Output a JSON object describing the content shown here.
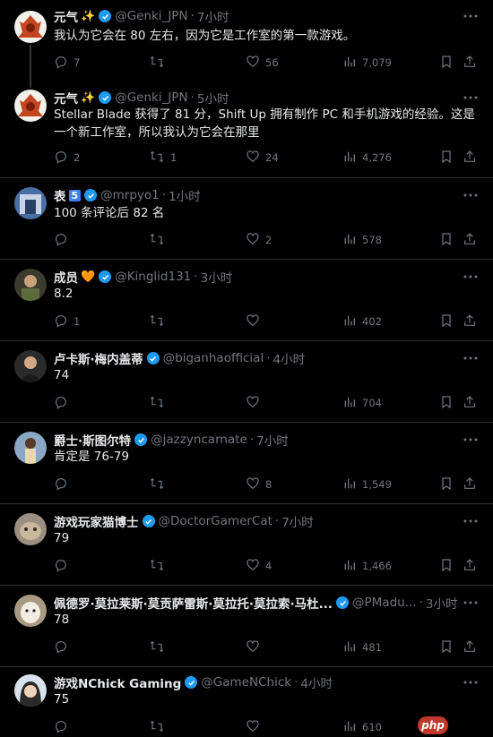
{
  "tweets": [
    {
      "name": "元气",
      "name_emoji": "✨",
      "handle": "@Genki_JPN",
      "time": "7小时",
      "text": "我认为它会在 80 左右，因为它是工作室的第一款游戏。",
      "replies": "7",
      "reposts": "",
      "likes": "56",
      "views": "7,079"
    },
    {
      "name": "元气",
      "name_emoji": "✨",
      "handle": "@Genki_JPN",
      "time": "5小时",
      "text": "Stellar Blade 获得了 81 分，Shift Up 拥有制作 PC 和手机游戏的经验。这是一个新工作室，所以我认为它会在那里",
      "replies": "2",
      "reposts": "1",
      "likes": "24",
      "views": "4,276"
    },
    {
      "name": "表",
      "name_emoji": "5",
      "handle": "@mrpyo1",
      "time": "1小时",
      "text": "100 条评论后 82 名",
      "replies": "",
      "reposts": "",
      "likes": "2",
      "views": "578"
    },
    {
      "name": "成员",
      "name_emoji": "🧡",
      "handle": "@Kinglid131",
      "time": "3小时",
      "text": "8.2",
      "replies": "1",
      "reposts": "",
      "likes": "",
      "views": "402"
    },
    {
      "name": "卢卡斯·梅内盖蒂",
      "name_emoji": "",
      "handle": "@biganhaofficial",
      "time": "4小时",
      "text": "74",
      "replies": "",
      "reposts": "",
      "likes": "",
      "views": "704"
    },
    {
      "name": "爵士·斯图尔特",
      "name_emoji": "",
      "handle": "@jazzyncarnate",
      "time": "7小时",
      "text": "肯定是 76-79",
      "replies": "",
      "reposts": "",
      "likes": "8",
      "views": "1,549"
    },
    {
      "name": "游戏玩家猫博士",
      "name_emoji": "",
      "handle": "@DoctorGamerCat",
      "time": "7小时",
      "text": "79",
      "replies": "",
      "reposts": "",
      "likes": "4",
      "views": "1,466"
    },
    {
      "name": "佩德罗·莫拉莱斯·莫贡萨雷斯·莫拉托·莫拉索·马杜...",
      "name_emoji": "",
      "handle": "@PMadu...",
      "time": "3小时",
      "text": "78",
      "replies": "",
      "reposts": "",
      "likes": "",
      "views": "481"
    },
    {
      "name": "游戏NChick Gaming",
      "name_emoji": "",
      "handle": "@GameNChick",
      "time": "4小时",
      "text": "75",
      "replies": "",
      "reposts": "",
      "likes": "",
      "views": "610"
    }
  ],
  "watermark": "php",
  "colors": {
    "bg": "#000000",
    "text": "#e7e9ea",
    "muted": "#71767b",
    "verified": "#1d9bf0",
    "separator": "#2f3336"
  },
  "icons": [
    "reply-icon",
    "repost-icon",
    "like-icon",
    "views-icon",
    "bookmark-icon",
    "share-icon",
    "more-icon",
    "verified-icon"
  ]
}
